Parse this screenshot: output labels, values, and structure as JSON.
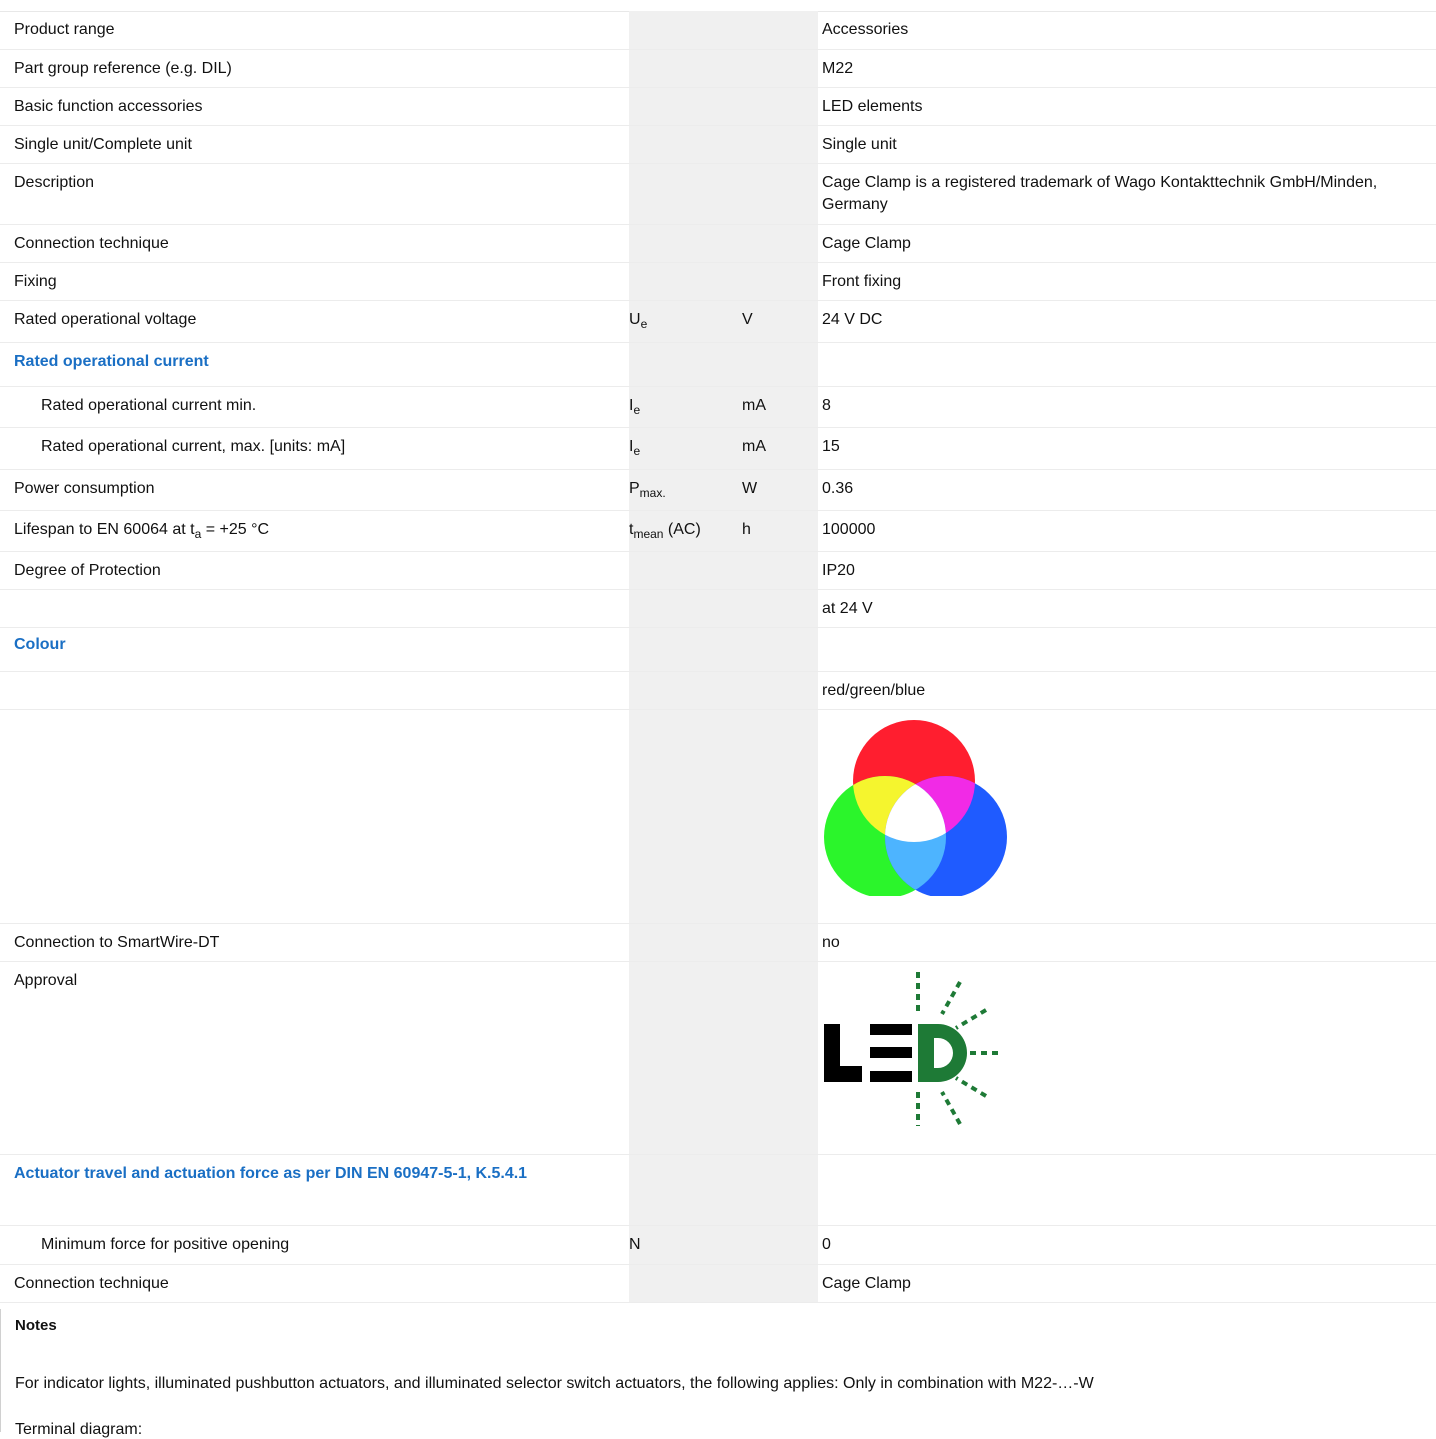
{
  "rows": {
    "r1": {
      "label": "Product range",
      "value": "Accessories"
    },
    "r2": {
      "label": "Part group reference (e.g. DIL)",
      "value": "M22"
    },
    "r3": {
      "label": "Basic function accessories",
      "value": "LED elements"
    },
    "r4": {
      "label": "Single unit/Complete unit",
      "value": "Single unit"
    },
    "r5": {
      "label": "Description",
      "value": "Cage Clamp is a registered trademark of Wago Kontakttechnik GmbH/Minden, Germany"
    },
    "r6": {
      "label": "Connection technique",
      "value": "Cage Clamp"
    },
    "r7": {
      "label": "Fixing",
      "value": "Front fixing"
    },
    "r8": {
      "label": "Rated operational voltage",
      "sym": "U",
      "sym_sub": "e",
      "unit": "V",
      "value": "24 V DC"
    },
    "s1": {
      "label": "Rated operational current"
    },
    "r9": {
      "label": "Rated operational current min.",
      "sym": "I",
      "sym_sub": "e",
      "unit": "mA",
      "value": "8"
    },
    "r10": {
      "label": "Rated operational current, max. [units: mA]",
      "sym": "I",
      "sym_sub": "e",
      "unit": "mA",
      "value": "15"
    },
    "r11": {
      "label": "Power consumption",
      "sym": "P",
      "sym_sub": "max.",
      "unit": "W",
      "value": "0.36"
    },
    "r12": {
      "label_pre": "Lifespan to EN 60064 at t",
      "label_sub": "a",
      "label_post": " = +25 °C",
      "sym": "t",
      "sym_sub": "mean",
      "sym_post": " (AC)",
      "unit": "h",
      "value": "100000"
    },
    "r13": {
      "label": "Degree of Protection",
      "value": "IP20"
    },
    "r14": {
      "label": "",
      "value": "at 24 V"
    },
    "s2": {
      "label": "Colour"
    },
    "r15": {
      "label": "",
      "value": "red/green/blue"
    },
    "r17": {
      "label": "Connection to SmartWire-DT",
      "value": "no"
    },
    "r18": {
      "label": "Approval",
      "logo_text": "LED"
    },
    "s3": {
      "label": "Actuator travel and actuation force as per DIN EN 60947-5-1, K.5.4.1"
    },
    "r19": {
      "label": "Minimum force for positive opening",
      "sym": "N",
      "value": "0"
    },
    "r20": {
      "label": "Connection technique",
      "value": "Cage Clamp"
    }
  },
  "notes": {
    "title": "Notes",
    "text": "For indicator lights, illuminated pushbutton actuators, and illuminated selector switch actuators, the following applies: Only in combination with M22-…-W",
    "diagram_label": "Terminal diagram:"
  },
  "colors": {
    "heading": "#1a6fc4",
    "red": "#ff1e2f",
    "green": "#2bf52b",
    "blue": "#1f5bff",
    "led_green": "#1e7a36"
  },
  "icons": [
    "rgb-color-circles-icon",
    "led-logo-icon"
  ]
}
